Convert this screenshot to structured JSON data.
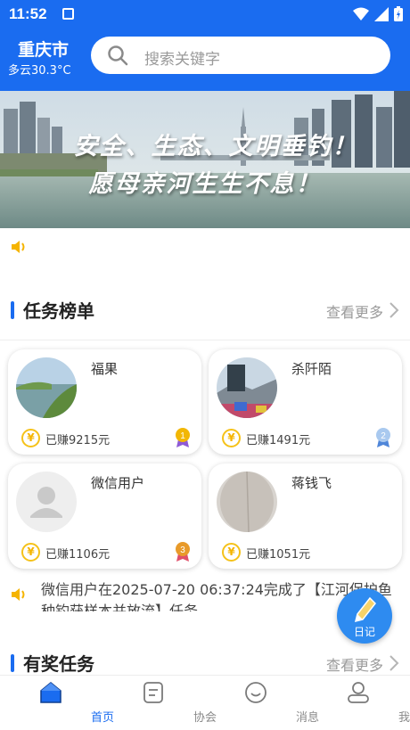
{
  "status_bar": {
    "time": "11:52"
  },
  "header": {
    "city": "重庆市",
    "weather": "多云30.3°C"
  },
  "search": {
    "placeholder": "搜索关键字"
  },
  "banner": {
    "line1": "安全、生态、文明垂钓！",
    "line2": "愿母亲河生生不息！"
  },
  "task_rank": {
    "title": "任务榜单",
    "more": "查看更多",
    "cards": [
      {
        "name": "福果",
        "earned": "已赚9215元",
        "rank": "1",
        "coin": "¥"
      },
      {
        "name": "杀阡陌",
        "earned": "已赚1491元",
        "rank": "2",
        "coin": "¥"
      },
      {
        "name": "微信用户",
        "earned": "已赚1106元",
        "rank": "3",
        "coin": "¥"
      },
      {
        "name": "蒋钱飞",
        "earned": "已赚1051元",
        "rank": "",
        "coin": "¥"
      }
    ]
  },
  "notice": {
    "text": "微信用户在2025-07-20 06:37:24完成了【江河保护鱼种钓获样本并放流】任务"
  },
  "reward_tasks": {
    "title": "有奖任务",
    "more": "查看更多"
  },
  "diary_button": {
    "label": "日记"
  },
  "tabs": [
    {
      "label": "首页",
      "icon": "home-icon",
      "active": true
    },
    {
      "label": "协会",
      "icon": "association-icon",
      "active": false
    },
    {
      "label": "消息",
      "icon": "message-icon",
      "active": false
    },
    {
      "label": "我的",
      "icon": "profile-icon",
      "active": false
    }
  ],
  "colors": {
    "primary": "#1a6cf0",
    "coin": "#f5c21a",
    "gold_medal": "#f2b705",
    "silver_medal": "#8fb6e8",
    "bronze_medal": "#e89a2a"
  }
}
